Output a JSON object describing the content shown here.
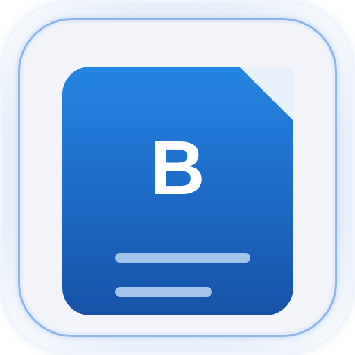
{
  "icon": {
    "letter": "B",
    "semantic": "document-b-icon",
    "colors": {
      "frame_fill": "#f2f4f9",
      "frame_border": "#8fb6ea",
      "doc_top": "#2585e0",
      "doc_bottom": "#1752a8",
      "fold": "#e8f0fb",
      "text_lines": "#a3c3e8",
      "letter": "#ffffff"
    }
  }
}
